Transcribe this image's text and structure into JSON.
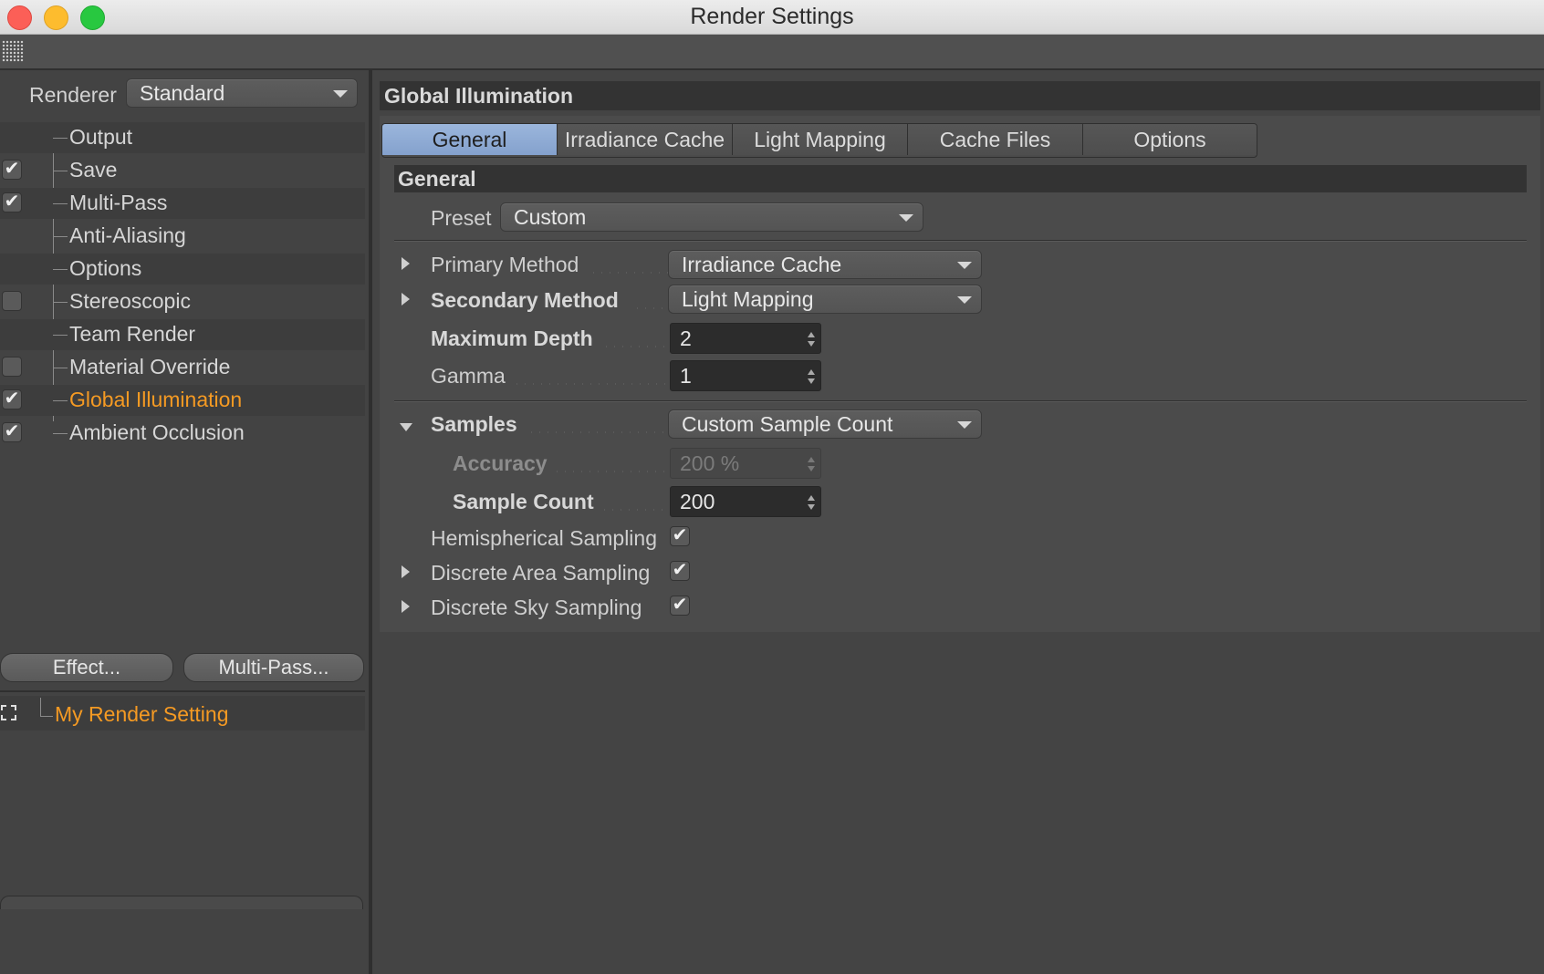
{
  "window": {
    "title": "Render Settings"
  },
  "sidebar": {
    "renderer_label": "Renderer",
    "renderer_value": "Standard",
    "items": [
      {
        "label": "Output",
        "check": ""
      },
      {
        "label": "Save",
        "check": "✔"
      },
      {
        "label": "Multi-Pass",
        "check": "✔"
      },
      {
        "label": "Anti-Aliasing",
        "check": ""
      },
      {
        "label": "Options",
        "check": ""
      },
      {
        "label": "Stereoscopic",
        "check": ""
      },
      {
        "label": "Team Render",
        "check": ""
      },
      {
        "label": "Material Override",
        "check": ""
      },
      {
        "label": "Global Illumination",
        "check": "✔"
      },
      {
        "label": "Ambient Occlusion",
        "check": "✔"
      }
    ],
    "effect_button": "Effect...",
    "multipass_button": "Multi-Pass...",
    "render_setting_name": "My Render Setting"
  },
  "main": {
    "section_title": "Global Illumination",
    "tabs": [
      "General",
      "Irradiance Cache",
      "Light Mapping",
      "Cache Files",
      "Options"
    ],
    "selected_tab": "General",
    "general_header": "General",
    "preset_label": "Preset",
    "preset_value": "Custom",
    "primary_method_label": "Primary Method",
    "primary_method_value": "Irradiance Cache",
    "secondary_method_label": "Secondary Method",
    "secondary_method_value": "Light Mapping",
    "max_depth_label": "Maximum Depth",
    "max_depth_value": "2",
    "gamma_label": "Gamma",
    "gamma_value": "1",
    "samples_label": "Samples",
    "samples_value": "Custom Sample Count",
    "accuracy_label": "Accuracy",
    "accuracy_value": "200 %",
    "sample_count_label": "Sample Count",
    "sample_count_value": "200",
    "hemispherical_label": "Hemispherical Sampling",
    "hemispherical_check": "✔",
    "discrete_area_label": "Discrete Area Sampling",
    "discrete_area_check": "✔",
    "discrete_sky_label": "Discrete Sky Sampling",
    "discrete_sky_check": "✔"
  },
  "colors": {
    "accent_orange": "#f59a23",
    "selected_tab": "#8fabd4",
    "panel_bg": "#434343"
  }
}
